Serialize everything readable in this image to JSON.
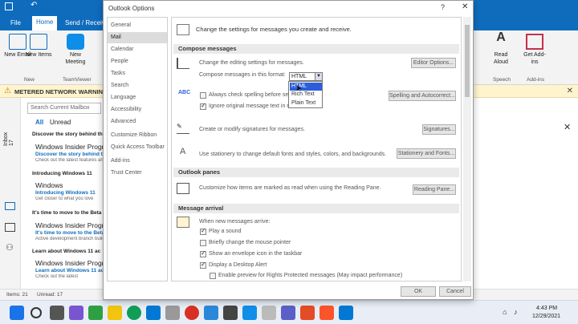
{
  "outlook": {
    "tabs": [
      "File",
      "Home",
      "Send / Receive"
    ],
    "ribbon": {
      "new_email": "New Email",
      "new_items": "New Items",
      "new_group_label": "New",
      "new_meeting": "New Meeting",
      "teamviewer_label": "TeamViewer",
      "read_aloud": "Read Aloud",
      "speech_label": "Speech",
      "get_addins": "Get Add-ins",
      "addins_label": "Add-ins"
    },
    "warning": "METERED NETWORK WARNING",
    "search_placeholder": "Search Current Mailbox",
    "filters": {
      "all": "All",
      "unread": "Unread"
    },
    "rail_label": "Inbox 17",
    "mail_items": [
      {
        "header": "Discover the story behind the",
        "title": "Windows Insider Progr",
        "subject": "Discover the story behind th",
        "preview": "Check out the latest features and"
      },
      {
        "header": "Introducing Windows 11",
        "title": "Windows",
        "subject": "Introducing Windows 11",
        "preview": "Get closer to what you love"
      },
      {
        "header": "It's time to move to the Beta",
        "title": "Windows Insider Progr",
        "subject": "It's time to move to the Beta",
        "preview": "Active development branch build"
      },
      {
        "header": "Learn about Windows 11 ac",
        "title": "Windows Insider Progr",
        "subject": "Learn about Windows 11 acc",
        "preview": "Check out the latest"
      }
    ],
    "status": {
      "items": "Items: 21",
      "unread": "Unread: 17"
    },
    "taskbar": {
      "time": "4:43 PM",
      "date": "12/29/2021"
    }
  },
  "dialog": {
    "title": "Outlook Options",
    "help": "?",
    "close": "✕",
    "nav": [
      "General",
      "Mail",
      "Calendar",
      "People",
      "Tasks",
      "Search",
      "Language",
      "Accessibility",
      "Advanced",
      "Customize Ribbon",
      "Quick Access Toolbar",
      "Add-ins",
      "Trust Center"
    ],
    "selected_nav": "Mail",
    "intro": "Change the settings for messages you create and receive.",
    "compose": {
      "header": "Compose messages",
      "editing_text": "Change the editing settings for messages.",
      "editor_options": "Editor Options...",
      "format_label": "Compose messages in this format:",
      "format_value": "HTML",
      "format_options": [
        "HTML",
        "Rich Text",
        "Plain Text"
      ],
      "always_check": "Always check spelling before sen",
      "ignore_original": "Ignore original message text in re",
      "spelling_btn": "Spelling and Autocorrect...",
      "signatures_text": "Create or modify signatures for messages.",
      "signatures_btn": "Signatures...",
      "stationery_text": "Use stationery to change default fonts and styles, colors, and backgrounds.",
      "stationery_btn": "Stationery and Fonts..."
    },
    "panes": {
      "header": "Outlook panes",
      "text": "Customize how items are marked as read when using the Reading Pane.",
      "btn": "Reading Pane..."
    },
    "arrival": {
      "header": "Message arrival",
      "when": "When new messages arrive:",
      "play_sound": "Play a sound",
      "change_pointer": "Briefly change the mouse pointer",
      "show_envelope": "Show an envelope icon in the taskbar",
      "desktop_alert": "Display a Desktop Alert",
      "rights_preview": "Enable preview for Rights Protected messages (May impact performance)"
    },
    "ok": "OK",
    "cancel": "Cancel"
  }
}
